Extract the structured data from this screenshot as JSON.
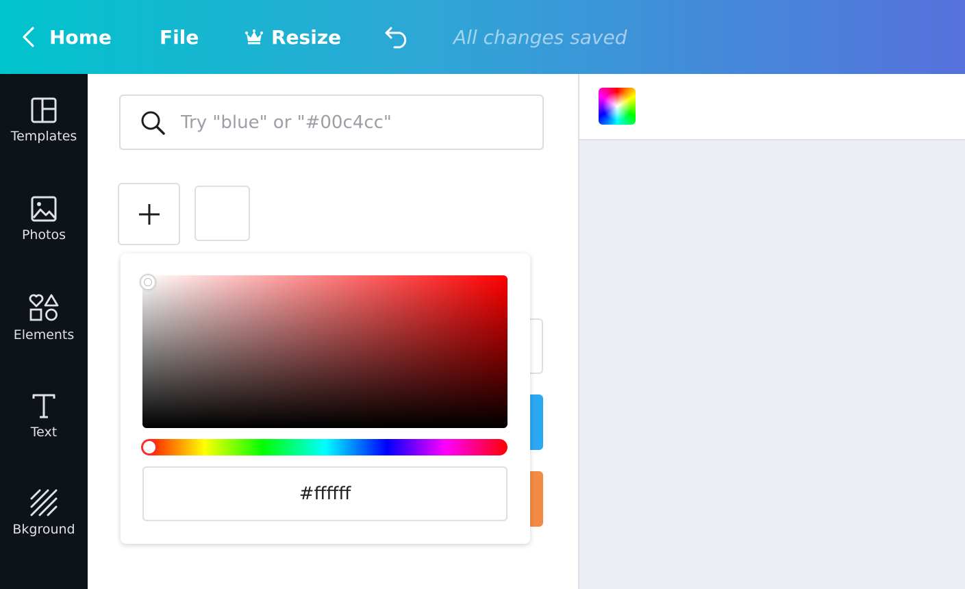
{
  "topbar": {
    "home_label": "Home",
    "file_label": "File",
    "resize_label": "Resize",
    "status": "All changes saved",
    "icons": {
      "back": "chevron-left-icon",
      "resize": "crown-icon",
      "undo": "undo-icon"
    },
    "gradient": [
      "#00c4cc",
      "#5671dc"
    ]
  },
  "sidebar": {
    "items": [
      {
        "label": "Templates",
        "icon": "templates-icon"
      },
      {
        "label": "Photos",
        "icon": "photo-icon"
      },
      {
        "label": "Elements",
        "icon": "shapes-icon"
      },
      {
        "label": "Text",
        "icon": "text-icon"
      },
      {
        "label": "Bkground",
        "icon": "background-icon"
      }
    ],
    "background": "#0e1318"
  },
  "panel": {
    "search": {
      "placeholder": "Try \"blue\" or \"#00c4cc\"",
      "icon": "search-icon"
    },
    "add_color_icon": "plus-icon",
    "swatches": [
      "#ffffff"
    ],
    "behind_swatches": [
      "#ffffff",
      "#2ba8f2",
      "#f28b45"
    ]
  },
  "color_picker": {
    "hex_value": "#ffffff",
    "hue_color": "#ff0000"
  },
  "canvas": {
    "toolbar_icon": "color-wheel-icon",
    "background": "#ebeef2"
  }
}
